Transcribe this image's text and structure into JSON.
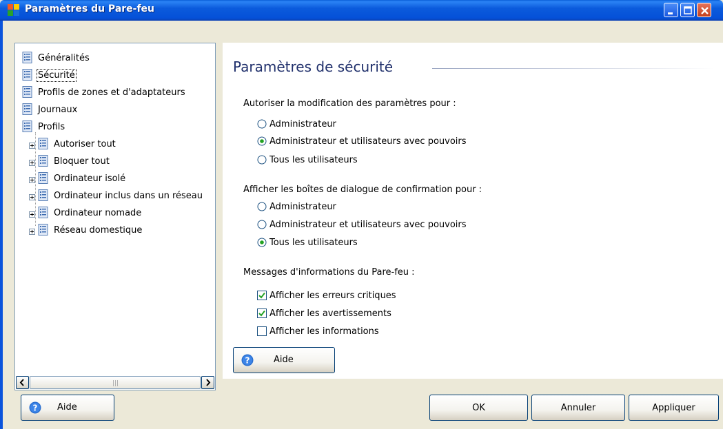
{
  "window": {
    "title": "Paramètres du Pare-feu",
    "controls": [
      "minimize-icon",
      "maximize-icon",
      "close-icon"
    ]
  },
  "tree": {
    "items": [
      {
        "label": "Généralités",
        "icon": "page-icon",
        "level": 0
      },
      {
        "label": "Sécurité",
        "icon": "page-icon",
        "level": 0,
        "selected": true
      },
      {
        "label": "Profils de zones et d'adaptateurs",
        "icon": "page-icon",
        "level": 0
      },
      {
        "label": "Journaux",
        "icon": "page-icon",
        "level": 0
      },
      {
        "label": "Profils",
        "icon": "page-icon",
        "level": 0
      },
      {
        "label": "Autoriser tout",
        "icon": "page-icon",
        "level": 1,
        "expandable": true
      },
      {
        "label": "Bloquer tout",
        "icon": "page-icon",
        "level": 1,
        "expandable": true
      },
      {
        "label": "Ordinateur isolé",
        "icon": "page-icon",
        "level": 1,
        "expandable": true
      },
      {
        "label": "Ordinateur inclus dans un réseau",
        "icon": "page-icon",
        "level": 1,
        "expandable": true
      },
      {
        "label": "Ordinateur nomade",
        "icon": "page-icon",
        "level": 1,
        "expandable": true
      },
      {
        "label": "Réseau domestique",
        "icon": "page-icon",
        "level": 1,
        "expandable": true
      }
    ],
    "scrollbar": {
      "grip": "III"
    }
  },
  "panel": {
    "title": "Paramètres de sécurité",
    "group1": {
      "label": "Autoriser la modification des paramètres pour :",
      "options": [
        {
          "label": "Administrateur",
          "checked": false
        },
        {
          "label": "Administrateur et utilisateurs avec pouvoirs",
          "checked": true
        },
        {
          "label": "Tous les utilisateurs",
          "checked": false
        }
      ]
    },
    "group2": {
      "label": "Afficher les boîtes de dialogue de confirmation pour :",
      "options": [
        {
          "label": "Administrateur",
          "checked": false
        },
        {
          "label": "Administrateur et utilisateurs avec pouvoirs",
          "checked": false
        },
        {
          "label": "Tous les utilisateurs",
          "checked": true
        }
      ]
    },
    "group3": {
      "label": "Messages d'informations du Pare-feu :",
      "options": [
        {
          "label": "Afficher les erreurs critiques",
          "checked": true
        },
        {
          "label": "Afficher les avertissements",
          "checked": true
        },
        {
          "label": "Afficher les informations",
          "checked": false
        }
      ]
    },
    "help_button": "Aide"
  },
  "footer": {
    "help_button": "Aide",
    "ok_button": "OK",
    "cancel_button": "Annuler",
    "apply_button": "Appliquer"
  },
  "colors": {
    "titlebar": "#0b5bdc",
    "panel_title": "#1f2f6b",
    "check": "#21a121",
    "radio_dot": "#21a121",
    "help_icon": "#2a6fd0"
  }
}
